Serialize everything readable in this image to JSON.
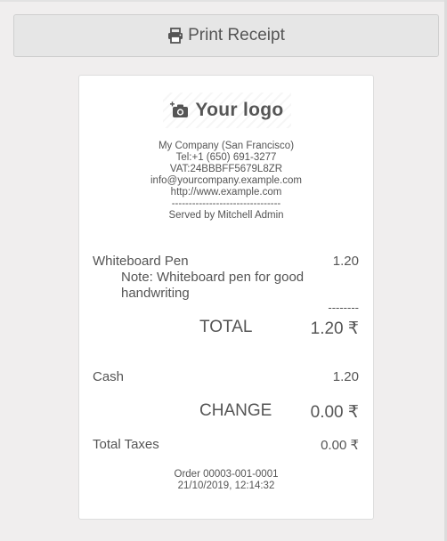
{
  "print_button": {
    "label": "Print Receipt",
    "icon": "printer-icon"
  },
  "receipt": {
    "logo": {
      "icon": "camera-plus-icon",
      "text": "Your logo"
    },
    "company": {
      "name": "My Company (San Francisco)",
      "tel": "Tel:+1 (650) 691-3277",
      "vat": "VAT:24BBBFF5679L8ZR",
      "email": "info@yourcompany.example.com",
      "website": "http://www.example.com",
      "separator": "--------------------------------",
      "served_by": "Served by Mitchell Admin"
    },
    "line": {
      "product": "Whiteboard Pen",
      "price": "1.20",
      "note_line1": "Note: Whiteboard pen for good",
      "note_line2": "handwriting"
    },
    "total": {
      "dashes": "--------",
      "label": "TOTAL",
      "value": "1.20 ₹"
    },
    "payment": {
      "method": "Cash",
      "amount": "1.20"
    },
    "change": {
      "label": "CHANGE",
      "value": "0.00 ₹"
    },
    "taxes": {
      "label": "Total Taxes",
      "value": "0.00 ₹"
    },
    "footer": {
      "order": "Order 00003-001-0001",
      "datetime": "21/10/2019, 12:14:32"
    }
  }
}
